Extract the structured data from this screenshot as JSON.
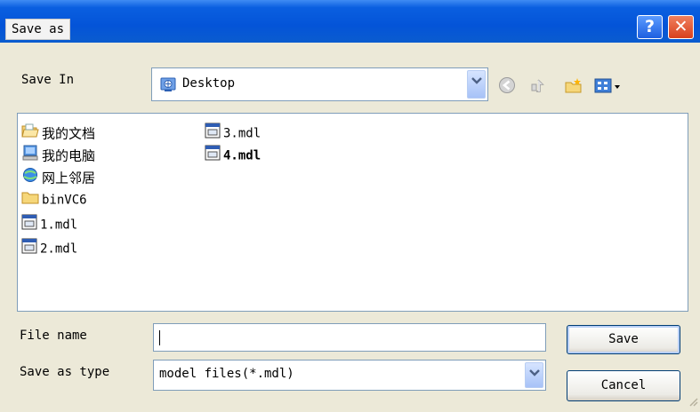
{
  "window": {
    "title": "Save as",
    "help_glyph": "?",
    "close_glyph": "✕"
  },
  "save_in": {
    "label": "Save In",
    "value": "Desktop"
  },
  "files": [
    {
      "name": "我的文档",
      "icon": "folder-open-icon"
    },
    {
      "name": "我的电脑",
      "icon": "computer-icon"
    },
    {
      "name": "网上邻居",
      "icon": "network-icon"
    },
    {
      "name": "binVC6",
      "icon": "folder-icon"
    },
    {
      "name": "1.mdl",
      "icon": "mdl-file-icon"
    },
    {
      "name": "2.mdl",
      "icon": "mdl-file-icon"
    },
    {
      "name": "3.mdl",
      "icon": "mdl-file-icon"
    },
    {
      "name": "4.mdl",
      "icon": "mdl-file-icon"
    }
  ],
  "file_name": {
    "label": "File name",
    "value": ""
  },
  "save_as_type": {
    "label": "Save as type",
    "value": "model files(*.mdl)"
  },
  "buttons": {
    "save": "Save",
    "cancel": "Cancel"
  }
}
